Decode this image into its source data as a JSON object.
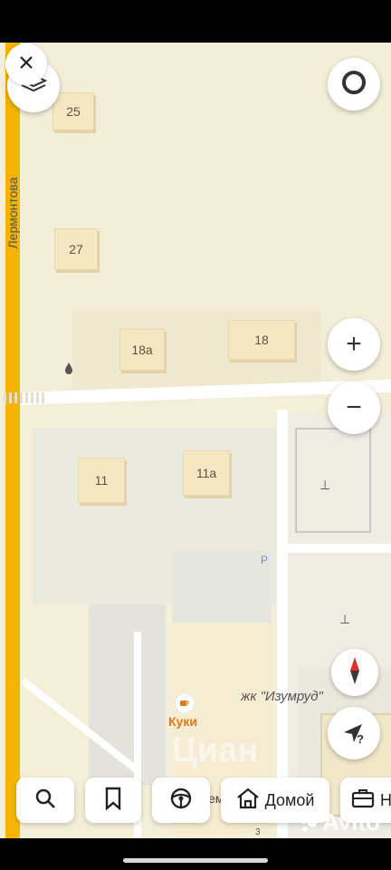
{
  "map": {
    "street_label": "Лермонтова",
    "buildings": [
      "25",
      "27",
      "18а",
      "18",
      "11",
      "11а"
    ],
    "poi_name": "Куки",
    "complex_label": "жк \"Изумруд\"",
    "parking_label": "P",
    "partial_label": "ем",
    "small_label": "3",
    "watermark": "Циан",
    "colors": {
      "ground": "#f4efd9",
      "block": "#ece8d8",
      "street": "#f4b400",
      "building": "#f6e7c3",
      "poi": "#e07b1a"
    }
  },
  "controls": {
    "close_icon": "close-icon",
    "layers_icon": "layers-icon",
    "compass_icon": "compass-ring-icon",
    "zoom_in_label": "+",
    "zoom_out_label": "−",
    "north_icon": "north-arrow-icon",
    "location_label": "?"
  },
  "bottom_bar": {
    "home_label": "Домой",
    "work_label_partial": "Н"
  },
  "overlay": {
    "watermark": "Avito"
  }
}
